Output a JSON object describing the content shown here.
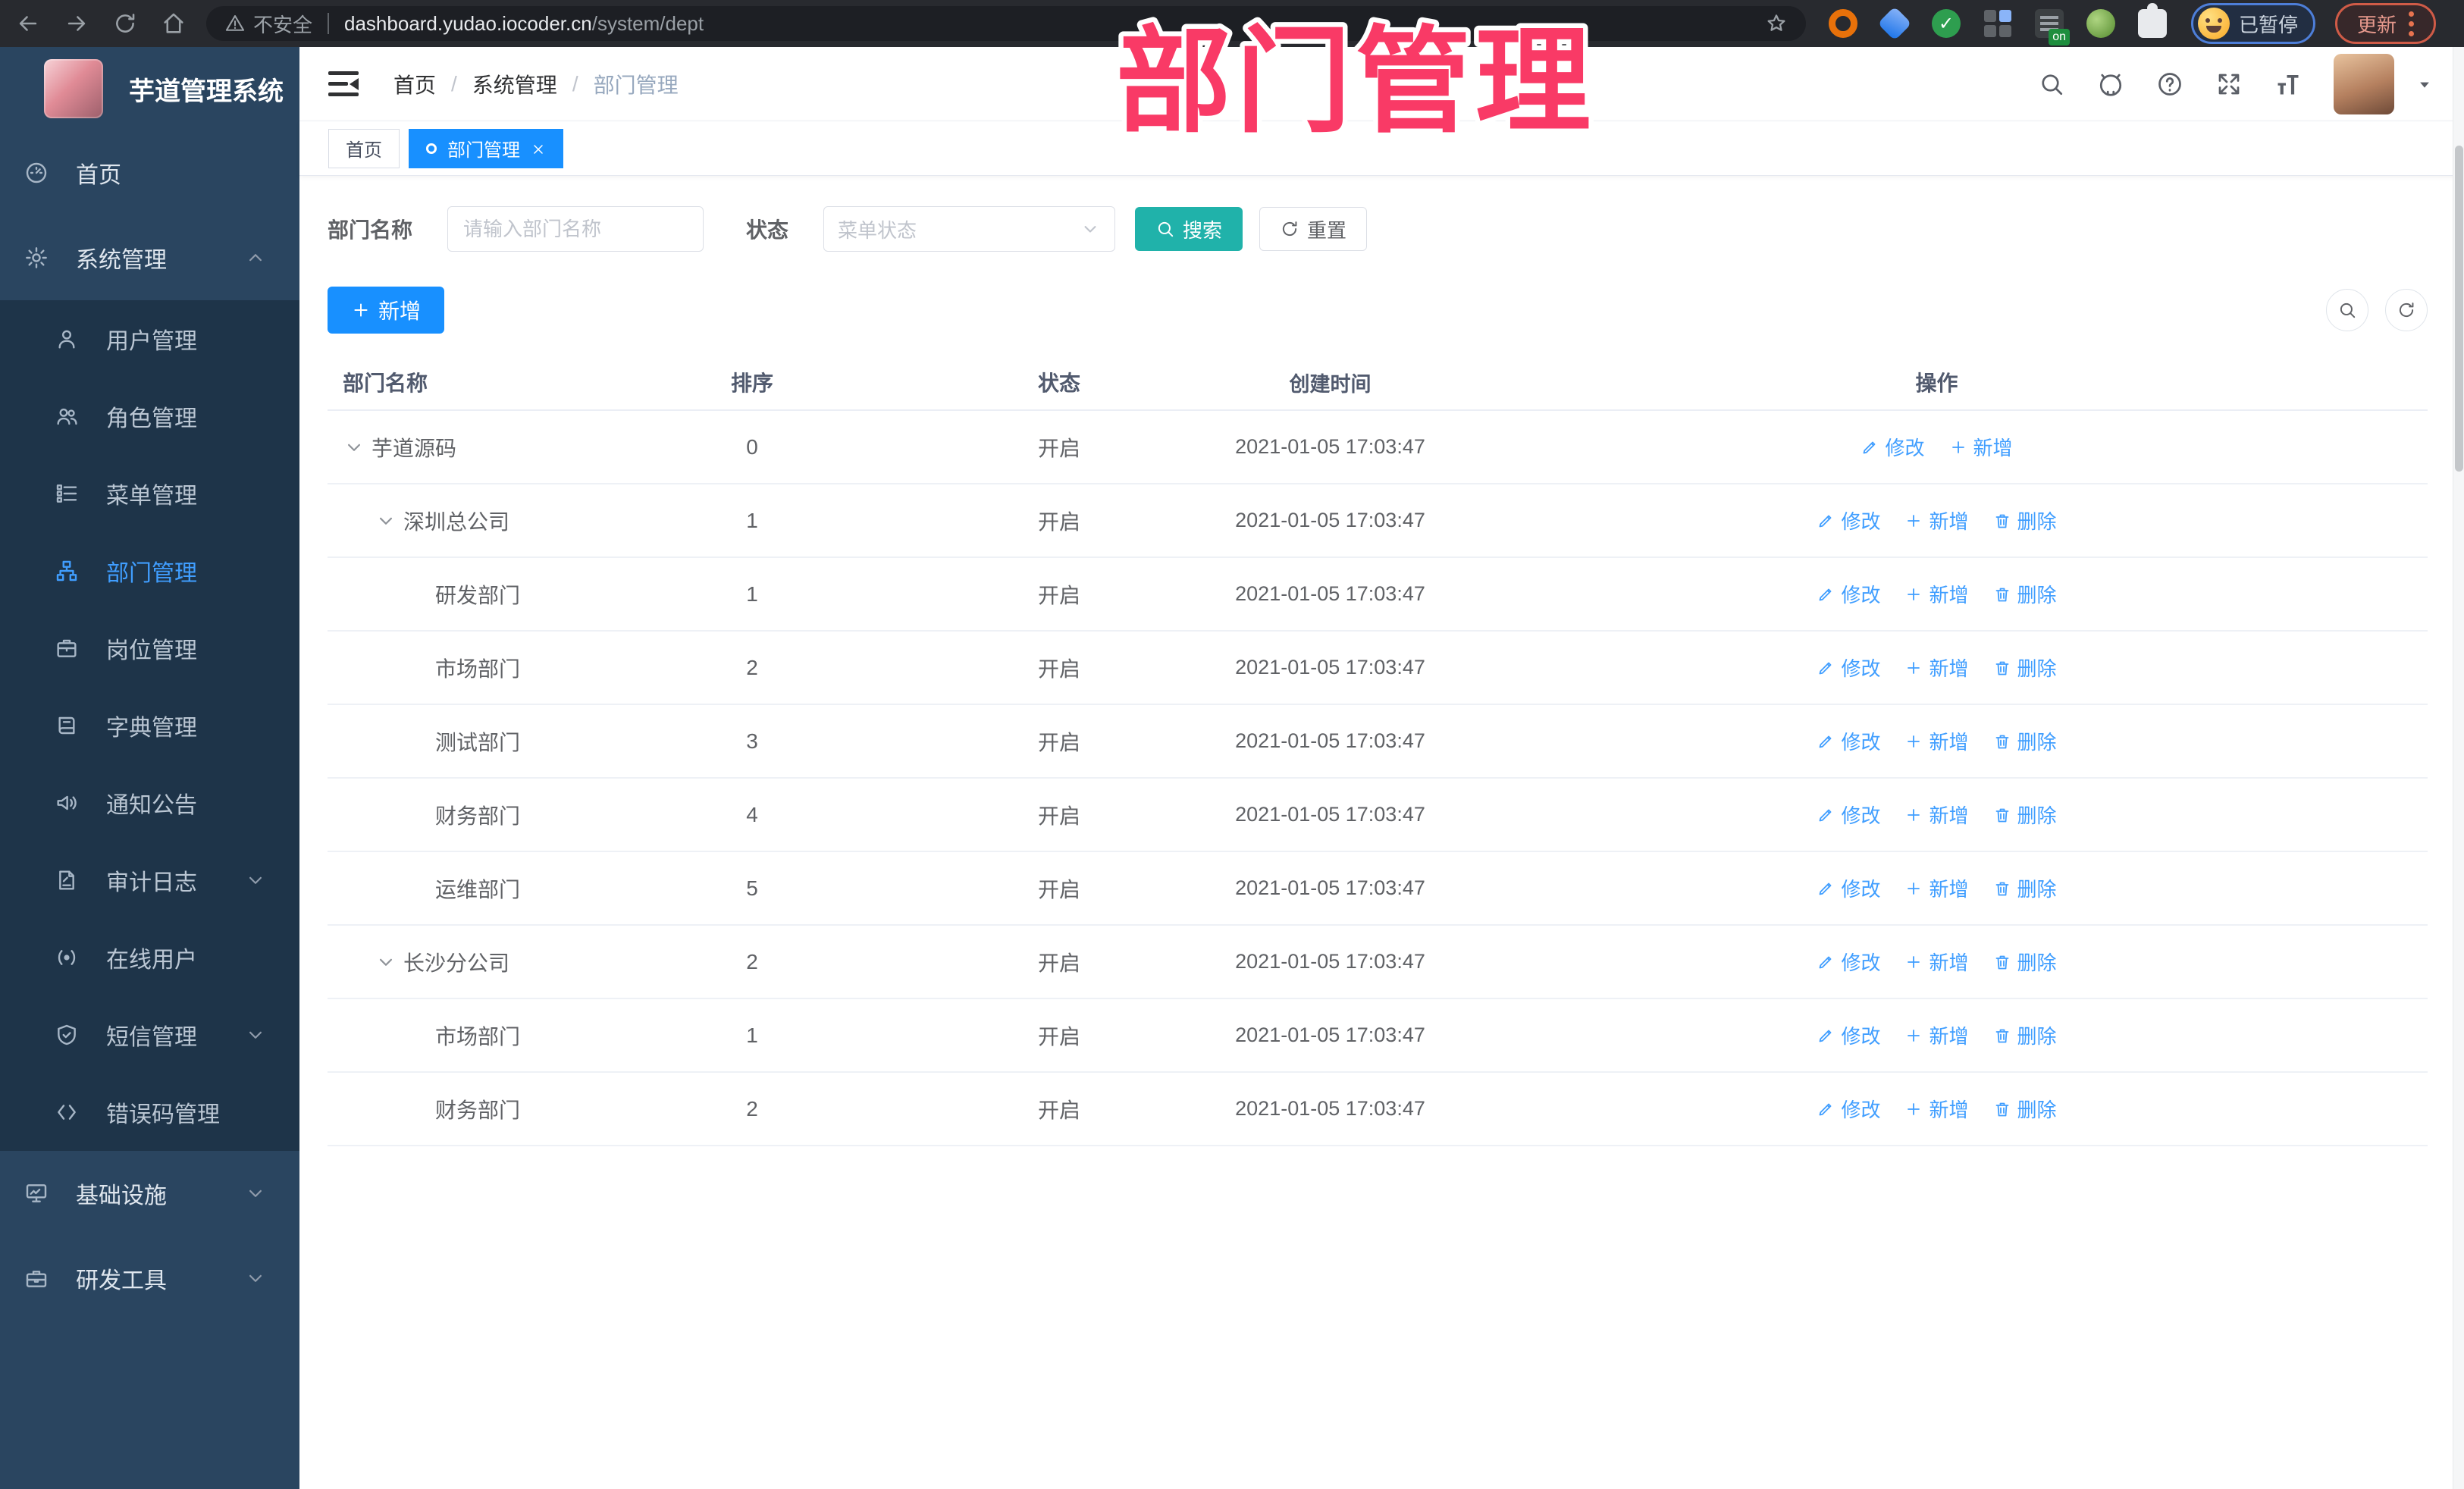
{
  "browser": {
    "security_label": "不安全",
    "url_host": "dashboard.yudao.iocoder.cn",
    "url_path": "/system/dept",
    "profile_status": "已暂停",
    "update_label": "更新"
  },
  "annotation": {
    "title": "部门管理"
  },
  "sidebar": {
    "app_title": "芋道管理系统",
    "items": [
      {
        "id": "home",
        "label": "首页",
        "icon": "dashboard",
        "type": "top"
      },
      {
        "id": "system",
        "label": "系统管理",
        "icon": "gear",
        "type": "top",
        "chevron": "up"
      },
      {
        "id": "user-mgmt",
        "label": "用户管理",
        "icon": "user",
        "type": "sub"
      },
      {
        "id": "role-mgmt",
        "label": "角色管理",
        "icon": "users",
        "type": "sub"
      },
      {
        "id": "menu-mgmt",
        "label": "菜单管理",
        "icon": "tree",
        "type": "sub"
      },
      {
        "id": "dept-mgmt",
        "label": "部门管理",
        "icon": "org",
        "type": "sub",
        "active": true
      },
      {
        "id": "post-mgmt",
        "label": "岗位管理",
        "icon": "badge",
        "type": "sub"
      },
      {
        "id": "dict-mgmt",
        "label": "字典管理",
        "icon": "book",
        "type": "sub"
      },
      {
        "id": "notice",
        "label": "通知公告",
        "icon": "notice",
        "type": "sub"
      },
      {
        "id": "audit-log",
        "label": "审计日志",
        "icon": "audit",
        "type": "sub",
        "chevron": "down"
      },
      {
        "id": "online-user",
        "label": "在线用户",
        "icon": "online",
        "type": "sub"
      },
      {
        "id": "sms-mgmt",
        "label": "短信管理",
        "icon": "sms",
        "type": "sub",
        "chevron": "down"
      },
      {
        "id": "errcode-mgmt",
        "label": "错误码管理",
        "icon": "code",
        "type": "sub"
      },
      {
        "id": "infra",
        "label": "基础设施",
        "icon": "infra",
        "type": "top",
        "chevron": "down"
      },
      {
        "id": "devtools",
        "label": "研发工具",
        "icon": "tools",
        "type": "top",
        "chevron": "down"
      }
    ]
  },
  "header": {
    "breadcrumb": [
      "首页",
      "系统管理",
      "部门管理"
    ]
  },
  "tabs": [
    {
      "label": "首页",
      "active": false
    },
    {
      "label": "部门管理",
      "active": true
    }
  ],
  "filters": {
    "name_label": "部门名称",
    "name_placeholder": "请输入部门名称",
    "status_label": "状态",
    "status_placeholder": "菜单状态",
    "search_label": "搜索",
    "reset_label": "重置"
  },
  "toolbar": {
    "add_label": "新增"
  },
  "table": {
    "columns": [
      "部门名称",
      "排序",
      "状态",
      "创建时间",
      "操作"
    ],
    "rows": [
      {
        "name": "芋道源码",
        "level": 1,
        "expandable": true,
        "sort": "0",
        "status": "开启",
        "created": "2021-01-05 17:03:47",
        "actions": [
          {
            "label": "修改",
            "icon": "edit"
          },
          {
            "label": "新增",
            "icon": "plus"
          }
        ]
      },
      {
        "name": "深圳总公司",
        "level": 2,
        "expandable": true,
        "sort": "1",
        "status": "开启",
        "created": "2021-01-05 17:03:47",
        "actions": [
          {
            "label": "修改",
            "icon": "edit"
          },
          {
            "label": "新增",
            "icon": "plus"
          },
          {
            "label": "删除",
            "icon": "trash"
          }
        ]
      },
      {
        "name": "研发部门",
        "level": 3,
        "expandable": false,
        "sort": "1",
        "status": "开启",
        "created": "2021-01-05 17:03:47",
        "actions": [
          {
            "label": "修改",
            "icon": "edit"
          },
          {
            "label": "新增",
            "icon": "plus"
          },
          {
            "label": "删除",
            "icon": "trash"
          }
        ]
      },
      {
        "name": "市场部门",
        "level": 3,
        "expandable": false,
        "sort": "2",
        "status": "开启",
        "created": "2021-01-05 17:03:47",
        "actions": [
          {
            "label": "修改",
            "icon": "edit"
          },
          {
            "label": "新增",
            "icon": "plus"
          },
          {
            "label": "删除",
            "icon": "trash"
          }
        ]
      },
      {
        "name": "测试部门",
        "level": 3,
        "expandable": false,
        "sort": "3",
        "status": "开启",
        "created": "2021-01-05 17:03:47",
        "actions": [
          {
            "label": "修改",
            "icon": "edit"
          },
          {
            "label": "新增",
            "icon": "plus"
          },
          {
            "label": "删除",
            "icon": "trash"
          }
        ]
      },
      {
        "name": "财务部门",
        "level": 3,
        "expandable": false,
        "sort": "4",
        "status": "开启",
        "created": "2021-01-05 17:03:47",
        "actions": [
          {
            "label": "修改",
            "icon": "edit"
          },
          {
            "label": "新增",
            "icon": "plus"
          },
          {
            "label": "删除",
            "icon": "trash"
          }
        ]
      },
      {
        "name": "运维部门",
        "level": 3,
        "expandable": false,
        "sort": "5",
        "status": "开启",
        "created": "2021-01-05 17:03:47",
        "actions": [
          {
            "label": "修改",
            "icon": "edit"
          },
          {
            "label": "新增",
            "icon": "plus"
          },
          {
            "label": "删除",
            "icon": "trash"
          }
        ]
      },
      {
        "name": "长沙分公司",
        "level": 2,
        "expandable": true,
        "sort": "2",
        "status": "开启",
        "created": "2021-01-05 17:03:47",
        "actions": [
          {
            "label": "修改",
            "icon": "edit"
          },
          {
            "label": "新增",
            "icon": "plus"
          },
          {
            "label": "删除",
            "icon": "trash"
          }
        ]
      },
      {
        "name": "市场部门",
        "level": 3,
        "expandable": false,
        "sort": "1",
        "status": "开启",
        "created": "2021-01-05 17:03:47",
        "actions": [
          {
            "label": "修改",
            "icon": "edit"
          },
          {
            "label": "新增",
            "icon": "plus"
          },
          {
            "label": "删除",
            "icon": "trash"
          }
        ]
      },
      {
        "name": "财务部门",
        "level": 3,
        "expandable": false,
        "sort": "2",
        "status": "开启",
        "created": "2021-01-05 17:03:47",
        "actions": [
          {
            "label": "修改",
            "icon": "edit"
          },
          {
            "label": "新增",
            "icon": "plus"
          },
          {
            "label": "删除",
            "icon": "trash"
          }
        ]
      }
    ]
  },
  "colors": {
    "primary": "#1890ff",
    "link": "#409eff",
    "search_button": "#20b2aa",
    "annotation": "#f93a66",
    "sidebar_bg": "#2a4560",
    "submenu_bg": "#1e3449"
  }
}
